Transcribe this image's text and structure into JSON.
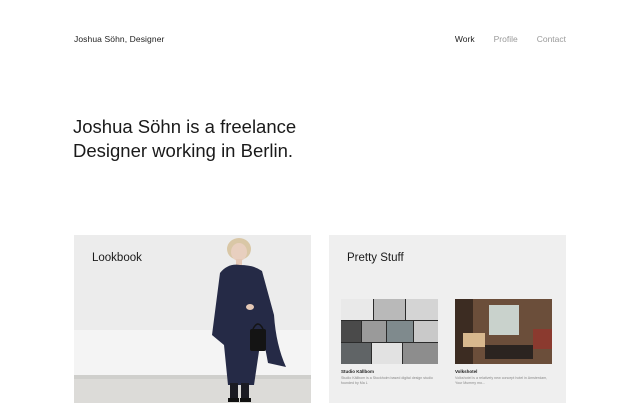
{
  "header": {
    "site_title": "Joshua Söhn, Designer",
    "nav": [
      {
        "label": "Work",
        "active": true
      },
      {
        "label": "Profile",
        "active": false
      },
      {
        "label": "Contact",
        "active": false
      }
    ]
  },
  "hero": {
    "line1": "Joshua Söhn is a freelance",
    "line2": "Designer working in Berlin."
  },
  "projects": [
    {
      "title": "Lookbook"
    },
    {
      "title": "Pretty Stuff",
      "items": [
        {
          "title": "Studio Källbom",
          "text": "Studio Källbom is a Stockholm based digital design studio founded by Ma L"
        },
        {
          "title": "Volkshotel",
          "text": "Volkshotel is a relatively new concept hotel in Amsterdam, Your Mummy mo..."
        }
      ]
    }
  ],
  "colors": {
    "text": "#1a1a1a",
    "nav_inactive": "#9a9a9a",
    "card_bg": "#efefef"
  }
}
